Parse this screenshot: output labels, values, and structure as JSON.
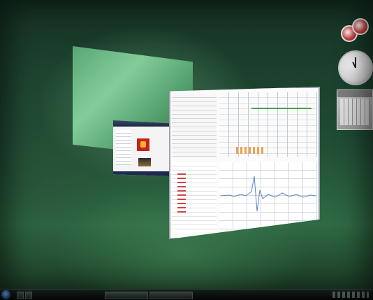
{
  "desktop": {
    "background_colors": [
      "#173425",
      "#2f6a44",
      "#8ad6a1"
    ]
  },
  "windows": [
    {
      "name": "back-window",
      "color": "#5fb07a"
    },
    {
      "name": "browser-window",
      "color": "#f4f4f4"
    },
    {
      "name": "spreadsheet-window",
      "color": "#fbfbfb"
    }
  ],
  "gadgets": {
    "photos_icon": "photo-slideshow-icon",
    "clock_icon": "analog-clock-icon",
    "calendar_icon": "calendar-icon"
  },
  "taskbar": {
    "start_icon": "windows-orb-icon",
    "accent": "#1c5aa5"
  }
}
